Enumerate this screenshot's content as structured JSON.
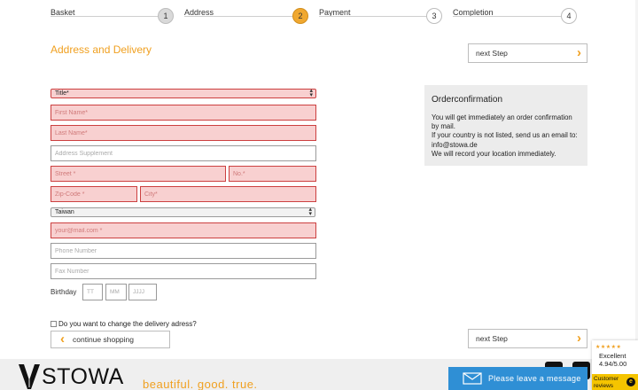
{
  "steps": [
    {
      "label": "Basket",
      "num": "1",
      "state": "done"
    },
    {
      "label": "Address",
      "num": "2",
      "state": "active"
    },
    {
      "label": "Payment",
      "num": "3",
      "state": "todo"
    },
    {
      "label": "Completion",
      "num": "4",
      "state": "todo"
    }
  ],
  "section_title": "Address and Delivery",
  "buttons": {
    "next_step_top": "next Step",
    "next_step_bottom": "next Step",
    "continue_shopping": "continue shopping"
  },
  "form": {
    "title_select": "Title*",
    "first_name_ph": "First Name*",
    "last_name_ph": "Last Name*",
    "address_supplement_ph": "Address Supplement",
    "street_ph": "Street *",
    "no_ph": "No.*",
    "zip_ph": "Zip-Code *",
    "city_ph": "City*",
    "country_select": "Taiwan",
    "email_ph": "your@mail.com *",
    "phone_ph": "Phone Number",
    "fax_ph": "Fax Number",
    "birthday_label": "Birthday",
    "bd_day_ph": "TT",
    "bd_month_ph": "MM",
    "bd_year_ph": "JJJJ",
    "delivery_change_label": "Do you want to change the delivery adress?"
  },
  "order_confirmation": {
    "title": "Orderconfirmation",
    "line1": "You will get immediately an order confirmation by mail.",
    "line2": "If your country is not listed, send us an email to:",
    "line3": "info@stowa.de",
    "line4": "We will record your location immediately."
  },
  "footer": {
    "brand": "STOWA",
    "tagline": "beautiful. good. true."
  },
  "message_widget": {
    "label": "Please leave a message"
  },
  "reviews_widget": {
    "stars": "★★★★★",
    "rating_label": "Excellent",
    "score": "4.94/5.00",
    "label": "Customer reviews",
    "badge": "e"
  },
  "colors": {
    "accent": "#f0a020",
    "error_bg": "#f8d0d0",
    "message_bar": "#2f8fd5"
  }
}
